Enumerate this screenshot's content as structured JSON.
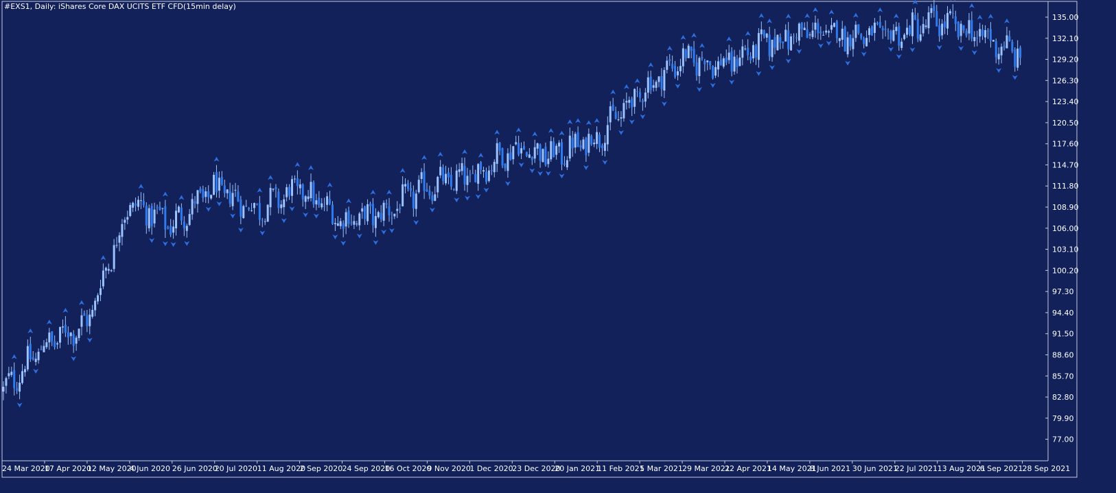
{
  "window": {
    "title": "#EXS1, Daily:  iShares Core DAX UCITS ETF CFD(15min delay)"
  },
  "colors": {
    "background": "#12215a",
    "frame": "#c8cde0",
    "text": "#ffffff",
    "candle_up": "#9cc3ff",
    "candle_down": "#2f7bf0",
    "wick": "#9cc3ff",
    "fractal_up": "#2e6fe0",
    "fractal_down": "#2e6fe0"
  },
  "chart_data": {
    "type": "candlestick",
    "title": "#EXS1, Daily:  iShares Core DAX UCITS ETF CFD(15min delay)",
    "xlabel": "",
    "ylabel": "",
    "ylim": [
      75.0,
      136.2
    ],
    "y_ticks": [
      "135.00",
      "132.10",
      "129.20",
      "126.30",
      "123.40",
      "120.50",
      "117.60",
      "114.70",
      "111.80",
      "108.90",
      "106.00",
      "103.10",
      "100.20",
      "97.30",
      "94.40",
      "91.50",
      "88.60",
      "85.70",
      "82.80",
      "79.90",
      "77.00"
    ],
    "x_tick_labels": [
      "24 Mar 2020",
      "17 Apr 2020",
      "12 May 2020",
      "4 Jun 2020",
      "26 Jun 2020",
      "20 Jul 2020",
      "11 Aug 2020",
      "2 Sep 2020",
      "24 Sep 2020",
      "16 Oct 2020",
      "9 Nov 2020",
      "1 Dec 2020",
      "23 Dec 2020",
      "20 Jan 2021",
      "11 Feb 2021",
      "5 Mar 2021",
      "29 Mar 2021",
      "22 Apr 2021",
      "14 May 2021",
      "8 Jun 2021",
      "30 Jun 2021",
      "22 Jul 2021",
      "13 Aug 2021",
      "6 Sep 2021",
      "28 Sep 2021"
    ],
    "grid": false,
    "legend": "none",
    "series": [
      {
        "label_date": "24 Mar 2020",
        "close": 83.5
      },
      {
        "label_date": "17 Apr 2020",
        "close": 90.0
      },
      {
        "label_date": "12 May 2020",
        "close": 93.0
      },
      {
        "label_date": "4 Jun 2020",
        "close": 109.5
      },
      {
        "label_date": "26 Jun 2020",
        "close": 106.5
      },
      {
        "label_date": "20 Jul 2020",
        "close": 111.5
      },
      {
        "label_date": "11 Aug 2020",
        "close": 108.5
      },
      {
        "label_date": "2 Sep 2020",
        "close": 111.5
      },
      {
        "label_date": "24 Sep 2020",
        "close": 107.0
      },
      {
        "label_date": "16 Oct 2020",
        "close": 108.0
      },
      {
        "label_date": "9 Nov 2020",
        "close": 111.8
      },
      {
        "label_date": "1 Dec 2020",
        "close": 113.0
      },
      {
        "label_date": "23 Dec 2020",
        "close": 117.0
      },
      {
        "label_date": "20 Jan 2021",
        "close": 116.0
      },
      {
        "label_date": "11 Feb 2021",
        "close": 118.5
      },
      {
        "label_date": "5 Mar 2021",
        "close": 124.5
      },
      {
        "label_date": "29 Mar 2021",
        "close": 129.3
      },
      {
        "label_date": "22 Apr 2021",
        "close": 128.5
      },
      {
        "label_date": "14 May 2021",
        "close": 131.5
      },
      {
        "label_date": "8 Jun 2021",
        "close": 133.0
      },
      {
        "label_date": "30 Jun 2021",
        "close": 132.5
      },
      {
        "label_date": "22 Jul 2021",
        "close": 132.5
      },
      {
        "label_date": "13 Aug 2021",
        "close": 134.5
      },
      {
        "label_date": "6 Sep 2021",
        "close": 132.5
      },
      {
        "label_date": "28 Sep 2021",
        "close": 129.6
      }
    ]
  }
}
